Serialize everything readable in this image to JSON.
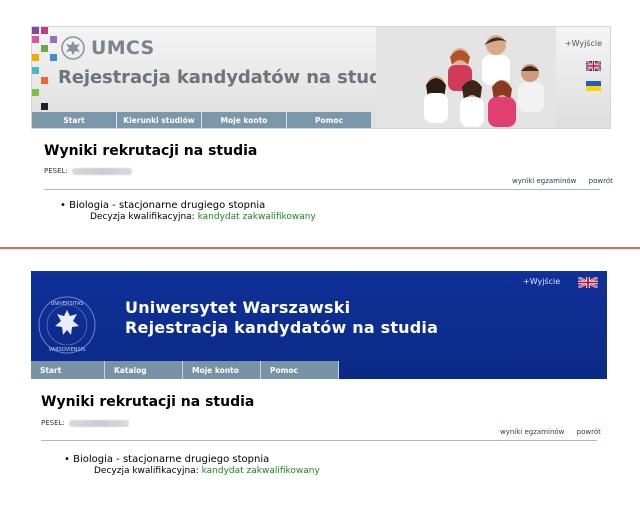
{
  "umcs": {
    "logo_text": "UMCS",
    "title": "Rejestracja kandydatów na studia",
    "exit_label": "+Wyjście",
    "nav": [
      "Start",
      "Kierunki studiów",
      "Moje konto",
      "Pomoc"
    ],
    "result_title": "Wyniki rekrutacji na studia",
    "pesel_label": "PESEL:",
    "links": [
      "wyniki egzaminów",
      "powrót"
    ],
    "program": "• Biologia - stacjonarne drugiego stopnia",
    "decision_label": "Decyzja kwalifikacyjna:",
    "decision_value": "kandydat zakwalifikowany",
    "colors": {
      "nav": "#7a97ab",
      "title": "#6e7479",
      "status": "#1a8a1a"
    }
  },
  "uw": {
    "title_line1": "Uniwersytet Warszawski",
    "title_line2": "Rejestracja kandydatów na studia",
    "exit_label": "+Wyjście",
    "seal_text": "UNIVERSITAS VARSOVIENSIS",
    "nav": [
      "Start",
      "Katalog",
      "Moje konto",
      "Pomoc"
    ],
    "result_title": "Wyniki rekrutacji na studia",
    "pesel_label": "PESEL:",
    "links": [
      "wyniki egzaminów",
      "powrót"
    ],
    "program": "• Biologia - stacjonarne drugiego stopnia",
    "decision_label": "Decyzja kwalifikacyjna:",
    "decision_value": "kandydat zakwalifikowany",
    "colors": {
      "header": "#10309a",
      "nav": "#7892a8",
      "status": "#1a8a1a"
    }
  },
  "icons": [
    "umcs-eagle-logo-icon",
    "uk-flag-icon",
    "ukraine-flag-icon",
    "uw-seal-icon"
  ]
}
